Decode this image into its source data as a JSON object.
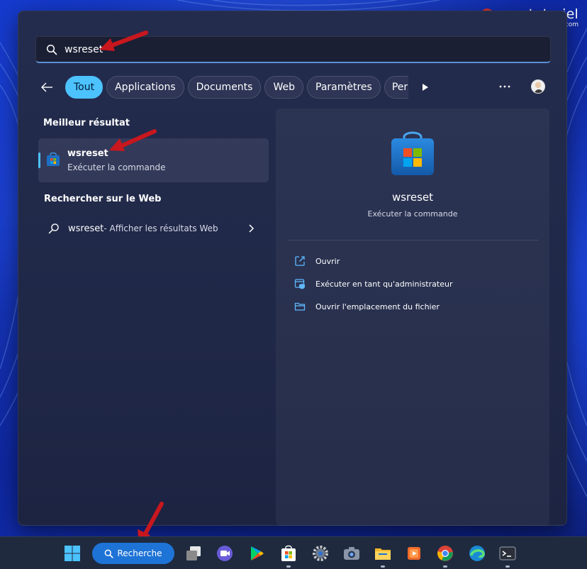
{
  "brand": {
    "text": "easytutoriel",
    "sub": ".com"
  },
  "search": {
    "value": "wsreset",
    "icon": "search-icon"
  },
  "filters": {
    "back_icon": "arrow-left-icon",
    "items": [
      {
        "label": "Tout",
        "active": true
      },
      {
        "label": "Applications",
        "active": false
      },
      {
        "label": "Documents",
        "active": false
      },
      {
        "label": "Web",
        "active": false
      },
      {
        "label": "Paramètres",
        "active": false
      },
      {
        "label": "Pers",
        "active": false
      }
    ],
    "more_icon": "more-options-icon"
  },
  "best_match": {
    "section_title": "Meilleur résultat",
    "name": "wsreset",
    "type": "Exécuter la commande",
    "icon": "microsoft-store-icon"
  },
  "web_search": {
    "section_title": "Rechercher sur le Web",
    "query": "wsreset",
    "suffix": " - Afficher les résultats Web"
  },
  "detail": {
    "title": "wsreset",
    "subtitle": "Exécuter la commande",
    "actions": [
      {
        "label": "Ouvrir",
        "icon": "open-external-icon"
      },
      {
        "label": "Exécuter en tant qu'administrateur",
        "icon": "shield-admin-icon"
      },
      {
        "label": "Ouvrir l'emplacement du fichier",
        "icon": "folder-icon"
      }
    ]
  },
  "taskbar": {
    "search_label": "Recherche",
    "items": [
      "windows-start-icon",
      "task-view-icon",
      "video-call-icon",
      "play-store-icon",
      "microsoft-store-icon",
      "settings-gear-icon",
      "camera-icon",
      "file-explorer-icon",
      "media-player-icon",
      "chrome-icon",
      "edge-icon",
      "terminal-icon"
    ]
  },
  "colors": {
    "accent": "#4cc2ff",
    "arrow": "#c8171e",
    "taskbar_search": "#1e73d6"
  }
}
